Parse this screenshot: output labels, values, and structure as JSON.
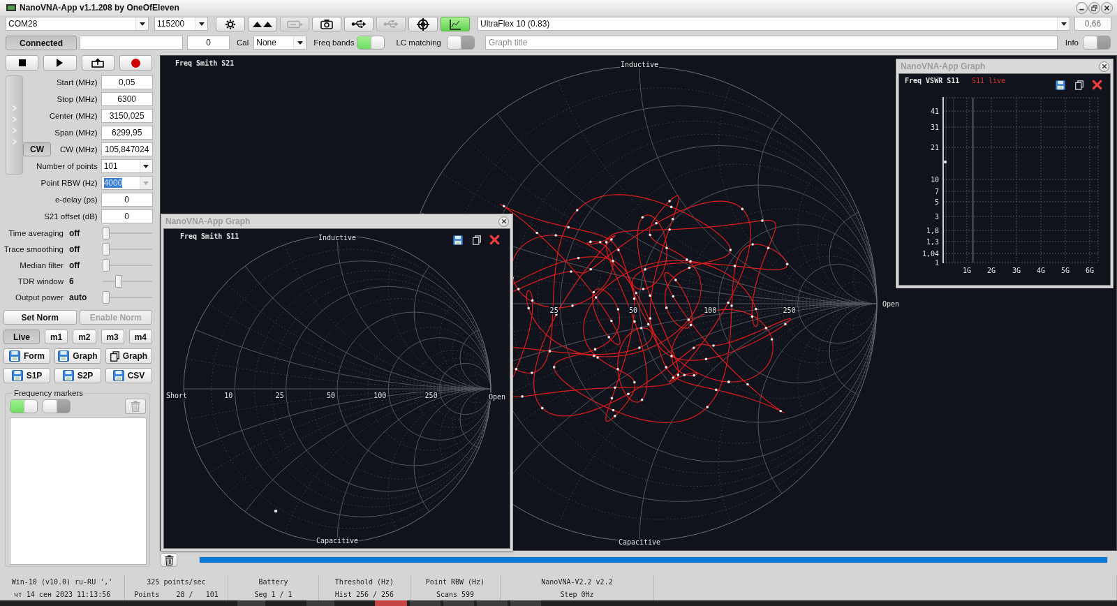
{
  "window": {
    "title": "NanoVNA-App v1.1.208 by OneOfEleven"
  },
  "connection": {
    "port": "COM28",
    "baud_rate": "115200"
  },
  "toolbar": [
    {
      "kind": "gear",
      "disabled": false,
      "on": false
    },
    {
      "kind": "triangles",
      "disabled": false,
      "on": false
    },
    {
      "kind": "battery",
      "disabled": true,
      "on": false
    },
    {
      "kind": "camera",
      "disabled": false,
      "on": false
    },
    {
      "kind": "usb",
      "disabled": false,
      "on": false
    },
    {
      "kind": "usb",
      "disabled": true,
      "on": false
    },
    {
      "kind": "crosshair",
      "disabled": false,
      "on": false
    },
    {
      "kind": "chart",
      "disabled": false,
      "on": true
    }
  ],
  "calibration_kit": {
    "name": "UltraFlex 10 (0.83)",
    "value": "0,66",
    "value_disabled": true
  },
  "options_bar": {
    "connect_button": "Connected",
    "counter": "0",
    "cal_label": "Cal",
    "cal_value": "None",
    "toggles": [
      {
        "label": "Freq bands",
        "on": true
      },
      {
        "label": "LC matching",
        "on": false
      }
    ],
    "graph_title": {
      "placeholder": "Graph title"
    },
    "info_toggle": {
      "label": "Info",
      "on": false
    }
  },
  "transport": [
    {
      "kind": "stop"
    },
    {
      "kind": "play"
    },
    {
      "kind": "tray"
    },
    {
      "kind": "record"
    }
  ],
  "sweep_fields": [
    {
      "kind": "input",
      "label": "Start (MHz)",
      "value": "0,05",
      "disabled": false,
      "text_selected": false
    },
    {
      "kind": "input",
      "label": "Stop (MHz)",
      "value": "6300",
      "disabled": false,
      "text_selected": false
    },
    {
      "kind": "input",
      "label": "Center (MHz)",
      "value": "3150,025",
      "disabled": false,
      "text_selected": false
    },
    {
      "kind": "input",
      "label": "Span (MHz)",
      "value": "6299,95",
      "disabled": false,
      "text_selected": false
    },
    {
      "kind": "input",
      "label": "CW (MHz)",
      "value": "105,847024",
      "button": "CW",
      "disabled": false,
      "text_selected": false
    },
    {
      "kind": "combo",
      "label": "Number of points",
      "value": "101",
      "disabled": false,
      "text_selected": false
    },
    {
      "kind": "combo",
      "label": "Point RBW (Hz)",
      "value": "4000",
      "disabled": true,
      "text_selected": true
    },
    {
      "kind": "input",
      "label": "e-delay (ps)",
      "value": "0",
      "disabled": false,
      "text_selected": false
    },
    {
      "kind": "input",
      "label": "S21 offset (dB)",
      "value": "0",
      "disabled": false,
      "text_selected": false
    }
  ],
  "filters": [
    {
      "label": "Time averaging",
      "reading": "off",
      "level": 0
    },
    {
      "label": "Trace smoothing",
      "reading": "off",
      "level": 0
    },
    {
      "label": "Median filter",
      "reading": "off",
      "level": 0
    },
    {
      "label": "TDR window",
      "reading": "6",
      "level": 0.3
    },
    {
      "label": "Output power",
      "reading": "auto",
      "level": 0
    }
  ],
  "norm_buttons": [
    {
      "label": "Set Norm",
      "disabled": false
    },
    {
      "label": "Enable Norm",
      "disabled": true
    }
  ],
  "trace_buttons": [
    {
      "label": "Live",
      "selected": true
    },
    {
      "label": "m1",
      "selected": false
    },
    {
      "label": "m2",
      "selected": false
    },
    {
      "label": "m3",
      "selected": false
    },
    {
      "label": "m4",
      "selected": false
    }
  ],
  "file_buttons": [
    {
      "label": "Form",
      "kind": "save"
    },
    {
      "label": "Graph",
      "kind": "save"
    },
    {
      "label": "Graph",
      "kind": "copy"
    },
    {
      "label": "S1P",
      "kind": "save"
    },
    {
      "label": "S2P",
      "kind": "save"
    },
    {
      "label": "CSV",
      "kind": "save"
    }
  ],
  "frequency_markers": {
    "title": "Frequency markers",
    "toggles": [
      {
        "on": true
      },
      {
        "on": false
      }
    ],
    "delete_disabled": true
  },
  "main_graph": {
    "title": "Freq Smith S21",
    "top_label": "Inductive",
    "bottom_label": "Capacitive",
    "resistance_labels": [
      "25",
      "50",
      "100",
      "250"
    ],
    "right_label": "Open"
  },
  "graph_windows": [
    {
      "kind": "smith",
      "window_title": "NanoVNA-App Graph",
      "active": false,
      "title": "Freq Smith S11",
      "top_label": "Inductive",
      "bottom_label": "Capacitive",
      "left_label": "Short",
      "resistance_labels": [
        "10",
        "25",
        "50",
        "100",
        "250"
      ],
      "right_label": "Open"
    },
    {
      "kind": "vswr",
      "window_title": "NanoVNA-App Graph",
      "active": false,
      "title": "Freq VSWR S11",
      "trace_label": "S11 live",
      "y_labels": [
        "41",
        "31",
        "21",
        "10",
        "7",
        "5",
        "3",
        "1,8",
        "1,3",
        "1,04",
        "1"
      ],
      "x_labels": [
        "1G",
        "2G",
        "3G",
        "4G",
        "5G",
        "6G"
      ]
    }
  ],
  "scan_progress": {
    "level": 1
  },
  "status_bar": {
    "rows": [
      [
        "Win-10 (v10.0) ru-RU ','",
        "325 points/sec",
        "Battery",
        "Threshold (Hz)",
        "Point RBW (Hz)",
        "NanoVNA-V2.2 v2.2"
      ],
      [
        "чт 14 сен 2023 11:13:56",
        "Points    28 /   101",
        "Seg 1 / 1",
        "Hist 256 / 256",
        "Scans 599",
        "Step 0Hz"
      ]
    ]
  }
}
